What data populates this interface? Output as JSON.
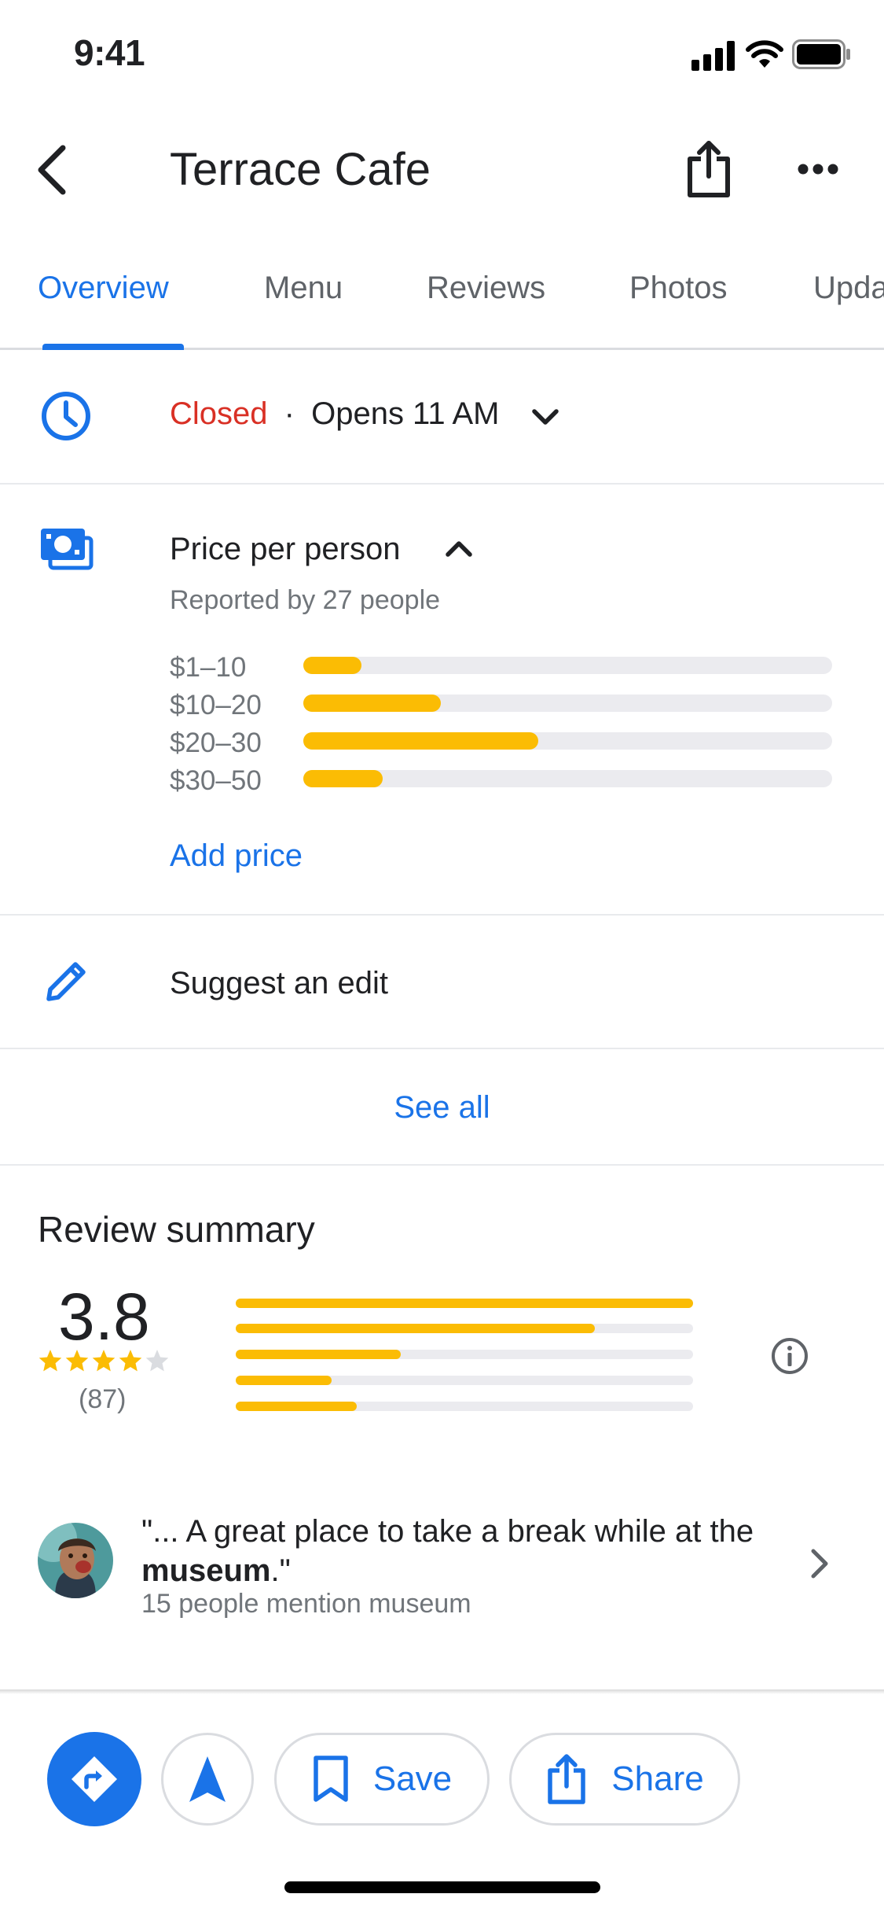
{
  "status_bar": {
    "time": "9:41"
  },
  "header": {
    "title": "Terrace Cafe"
  },
  "tabs": [
    {
      "label": "Overview",
      "active": true
    },
    {
      "label": "Menu"
    },
    {
      "label": "Reviews"
    },
    {
      "label": "Photos"
    },
    {
      "label": "Upda"
    }
  ],
  "hours": {
    "status": "Closed",
    "separator": "·",
    "opens": "Opens 11 AM"
  },
  "price": {
    "title": "Price per person",
    "reported": "Reported by 27 people",
    "ranges": [
      {
        "label": "$1–10",
        "fraction": 0.11
      },
      {
        "label": "$10–20",
        "fraction": 0.26
      },
      {
        "label": "$20–30",
        "fraction": 0.445
      },
      {
        "label": "$30–50",
        "fraction": 0.15
      }
    ],
    "add_price": "Add price"
  },
  "suggest_edit": "Suggest an edit",
  "see_all": "See all",
  "review_summary": {
    "title": "Review summary",
    "rating": "3.8",
    "stars_filled": 4,
    "count": "(87)",
    "bars": [
      {
        "stars": 5,
        "fraction": 1.0
      },
      {
        "stars": 4,
        "fraction": 0.785
      },
      {
        "stars": 3,
        "fraction": 0.36
      },
      {
        "stars": 2,
        "fraction": 0.21
      },
      {
        "stars": 1,
        "fraction": 0.265
      }
    ]
  },
  "mention": {
    "quote_prefix": "\"... A great place to take a break while at the ",
    "quote_bold": "museum",
    "quote_suffix": ".\"",
    "count_text": "15 people mention museum"
  },
  "actions": {
    "save": "Save",
    "share": "Share"
  },
  "colors": {
    "accent": "#1a73e8",
    "closed": "#d93025",
    "bar": "#fbbc04",
    "track": "#ebebef"
  }
}
